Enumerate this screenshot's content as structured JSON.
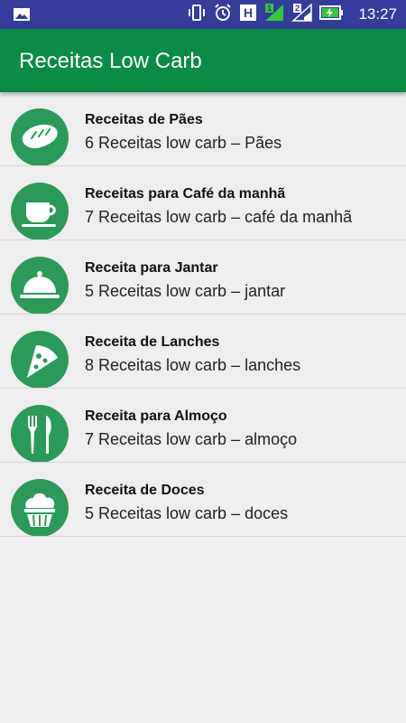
{
  "status_bar": {
    "time": "13:27",
    "icons": [
      "image-notification-icon",
      "vibrate-icon",
      "alarm-icon",
      "h-network-icon",
      "signal-sim1-icon",
      "signal-sim2-icon",
      "battery-charging-icon"
    ],
    "sim1_label": "1",
    "sim2_label": "2",
    "network_label": "H"
  },
  "app_bar": {
    "title": "Receitas Low Carb",
    "color": "#0b8c45"
  },
  "colors": {
    "accent": "#2b9a58",
    "status_bar": "#343c9c",
    "background": "#eeeeee"
  },
  "categories": [
    {
      "title": "Receitas de Pães",
      "subtitle": "6 Receitas low carb – Pães",
      "icon": "bread-icon"
    },
    {
      "title": "Receitas para Café da manhã",
      "subtitle": "7 Receitas low carb – café da manhã",
      "icon": "coffee-cup-icon"
    },
    {
      "title": "Receita para Jantar",
      "subtitle": "5 Receitas low carb – jantar",
      "icon": "cloche-icon"
    },
    {
      "title": "Receita de Lanches",
      "subtitle": "8 Receitas low carb – lanches",
      "icon": "pizza-slice-icon"
    },
    {
      "title": "Receita para Almoço",
      "subtitle": "7 Receitas low carb – almoço",
      "icon": "fork-knife-icon"
    },
    {
      "title": "Receita de Doces",
      "subtitle": "5 Receitas low carb – doces",
      "icon": "cupcake-icon"
    }
  ]
}
